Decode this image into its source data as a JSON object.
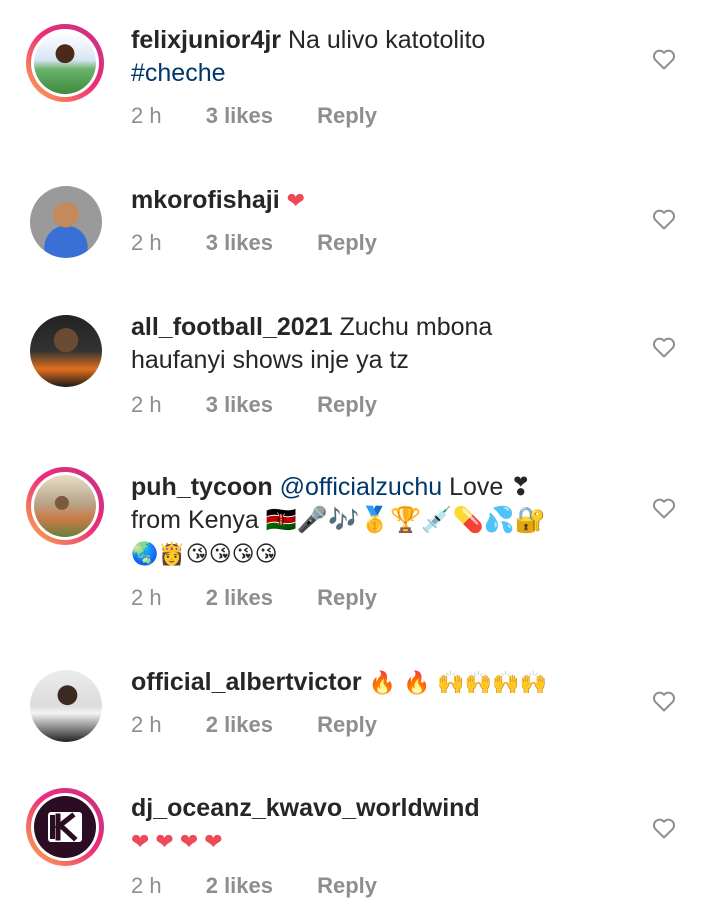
{
  "comments": [
    {
      "username": "felixjunior4jr",
      "text": "Na ulivo katotolito",
      "hashtag": "#cheche",
      "time": "2 h",
      "likes": "3 likes",
      "reply": "Reply",
      "story_ring": true
    },
    {
      "username": "mkorofishaji",
      "text": "❤",
      "time": "2 h",
      "likes": "3 likes",
      "reply": "Reply",
      "story_ring": false
    },
    {
      "username": "all_football_2021",
      "text": "Zuchu mbona",
      "text2": "haufanyi shows inje ya tz",
      "time": "2 h",
      "likes": "3 likes",
      "reply": "Reply",
      "story_ring": false
    },
    {
      "username": "puh_tycoon",
      "mention": "@officialzuchu",
      "text": "Love ❣",
      "text2": "from Kenya 🇰🇪🎤🎶🥇🏆💉💊💦🔐",
      "text3": "🌏👸😘😘😘😘",
      "time": "2 h",
      "likes": "2 likes",
      "reply": "Reply",
      "story_ring": true
    },
    {
      "username": "official_albertvictor",
      "text": "🔥 🔥 🙌🙌🙌🙌",
      "time": "2 h",
      "likes": "2 likes",
      "reply": "Reply",
      "story_ring": false
    },
    {
      "username": "dj_oceanz_kwavo_worldwind",
      "text": "❤❤❤❤",
      "time": "2 h",
      "likes": "2 likes",
      "reply": "Reply",
      "story_ring": true
    }
  ],
  "icons": {
    "like": "heart-outline-icon"
  },
  "colors": {
    "text": "#262626",
    "meta": "#8e8e8e",
    "link": "#00376b",
    "heart": "#ed4956"
  }
}
